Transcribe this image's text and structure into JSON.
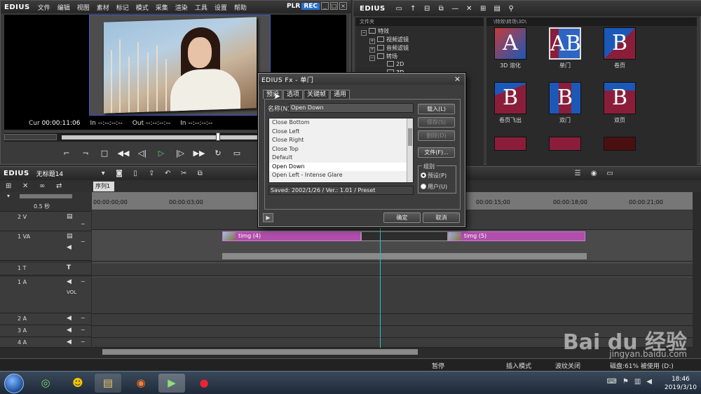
{
  "preview": {
    "logo": "EDIUS",
    "menu": [
      "文件",
      "编辑",
      "视图",
      "素材",
      "标记",
      "模式",
      "采集",
      "渲染",
      "工具",
      "设置",
      "帮助"
    ],
    "plr": "PLR",
    "rec": "REC",
    "cur_label": "Cur",
    "cur_value": "00:00:11:06",
    "in_label": "In",
    "in_value": "--:--:--:--",
    "out_label": "Out",
    "out_value": "--:--:--:--",
    "dur_label": "In",
    "dur_value": "--:--:--:--"
  },
  "bin": {
    "logo": "EDIUS",
    "folder_header": "文件夹",
    "path": "\\特效\\转场\\3D\\",
    "tree": [
      {
        "label": "特效",
        "indent": 0
      },
      {
        "label": "视频滤镜",
        "indent": 1
      },
      {
        "label": "音频滤镜",
        "indent": 1
      },
      {
        "label": "转场",
        "indent": 1
      },
      {
        "label": "2D",
        "indent": 2
      },
      {
        "label": "3D",
        "indent": 2
      }
    ],
    "tiles": [
      {
        "label": "3D 溶化",
        "letter": "A",
        "bg": "#c23b3b"
      },
      {
        "label": "单门",
        "letter": "AB",
        "bg": "#2e64c2"
      },
      {
        "label": "卷页",
        "letter": "B",
        "bg": "#1c58b8"
      },
      {
        "label": "卷页飞出",
        "letter": "B",
        "bg": "#8a1e3a"
      },
      {
        "label": "双门",
        "letter": "B",
        "bg": "#1c58b8"
      },
      {
        "label": "双页",
        "letter": "B",
        "bg": "#8a1e3a"
      }
    ]
  },
  "timeline": {
    "logo": "EDIUS",
    "project": "无标题14",
    "sequence_tab": "序列1",
    "zoom": "0.5 秒",
    "ruler": [
      "00:00:00;00",
      "00:00:03;00",
      "00:00:15;00",
      "00:00:18;00",
      "00:00:21;00"
    ],
    "tracks": [
      {
        "label": "2 V"
      },
      {
        "label": "1 VA"
      },
      {
        "label": "1 T"
      },
      {
        "label": "1 A"
      },
      {
        "label": "2 A"
      },
      {
        "label": "3 A"
      },
      {
        "label": "4 A"
      }
    ],
    "vol": "VOL",
    "clip_a": "timg (4)",
    "clip_b": "timg (5)"
  },
  "status": {
    "pause": "暂停",
    "insert": "插入模式",
    "ripple": "波纹关闭",
    "disk": "磁盘:61% 被使用 (D:)"
  },
  "dialog": {
    "title": "EDIUS Fx - 单门",
    "tabs": [
      "预设",
      "选项",
      "关键帧",
      "通用"
    ],
    "name_label": "名称(N)",
    "name_value": "Open Down",
    "presets": [
      "Close Bottom",
      "Close Left",
      "Close Right",
      "Close Top",
      "Default",
      "Open Down",
      "Open Left - Intense Glare"
    ],
    "selected_preset": "Open Down",
    "saved": "Saved: 2002/1/26 / Ver.: 1.01 / Preset",
    "load": "载入(L)",
    "save": "保存(S)",
    "delete": "删除(D)",
    "file": "文件(F)...",
    "group": "组别",
    "radio_preset": "预设(P)",
    "radio_user": "用户(U)",
    "ok": "确定",
    "cancel": "取消"
  },
  "taskbar": {
    "time": "18:46",
    "date": "2019/3/10"
  },
  "watermark": {
    "brand": "Bai du 经验",
    "site": "jingyan.baidu.com"
  }
}
